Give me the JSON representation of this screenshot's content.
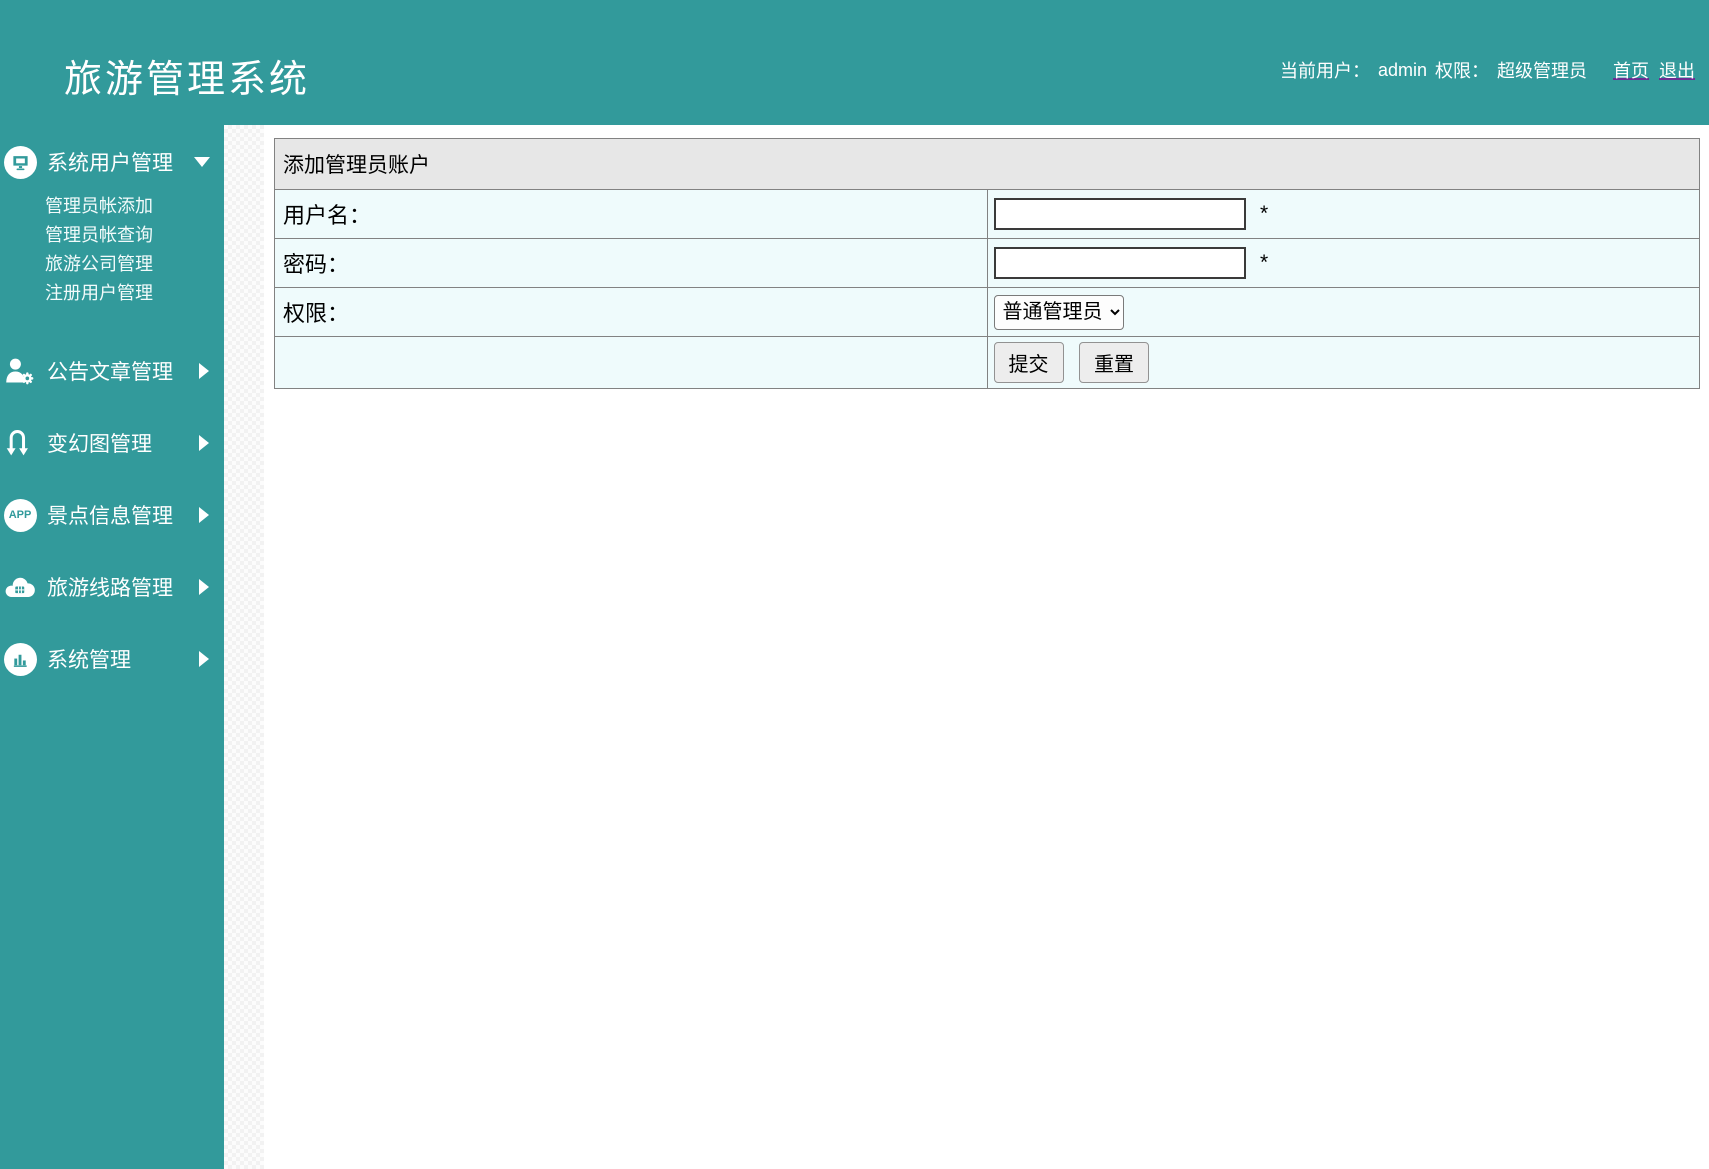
{
  "app": {
    "title": "旅游管理系统"
  },
  "header": {
    "current_user_label": "当前用户：",
    "current_user": "admin",
    "role_label": "权限：",
    "role": "超级管理员",
    "home_link": "首页",
    "logout_link": "退出"
  },
  "sidebar": {
    "items": [
      {
        "label": "系统用户管理",
        "icon": "monitor-circle-icon",
        "expanded": true,
        "children": [
          "管理员帐添加",
          "管理员帐查询",
          "旅游公司管理",
          "注册用户管理"
        ]
      },
      {
        "label": "公告文章管理",
        "icon": "user-gear-icon"
      },
      {
        "label": "变幻图管理",
        "icon": "swap-arrows-icon"
      },
      {
        "label": "景点信息管理",
        "icon": "app-circle-icon",
        "icon_text": "APP"
      },
      {
        "label": "旅游线路管理",
        "icon": "cloud-icon"
      },
      {
        "label": "系统管理",
        "icon": "bar-chart-circle-icon"
      }
    ]
  },
  "form": {
    "title": "添加管理员账户",
    "fields": [
      {
        "label": "用户名：",
        "required_mark": "*",
        "value": ""
      },
      {
        "label": "密码：",
        "required_mark": "*",
        "value": ""
      },
      {
        "label": "权限：",
        "selected_option": "普通管理员"
      }
    ],
    "buttons": {
      "submit": "提交",
      "reset": "重置"
    }
  },
  "colors": {
    "teal": "#329a9b",
    "row_bg": "#effbfc",
    "table_header_bg": "#e7e7e7",
    "table_border": "#828282",
    "link_underline": "#6c2d92"
  }
}
